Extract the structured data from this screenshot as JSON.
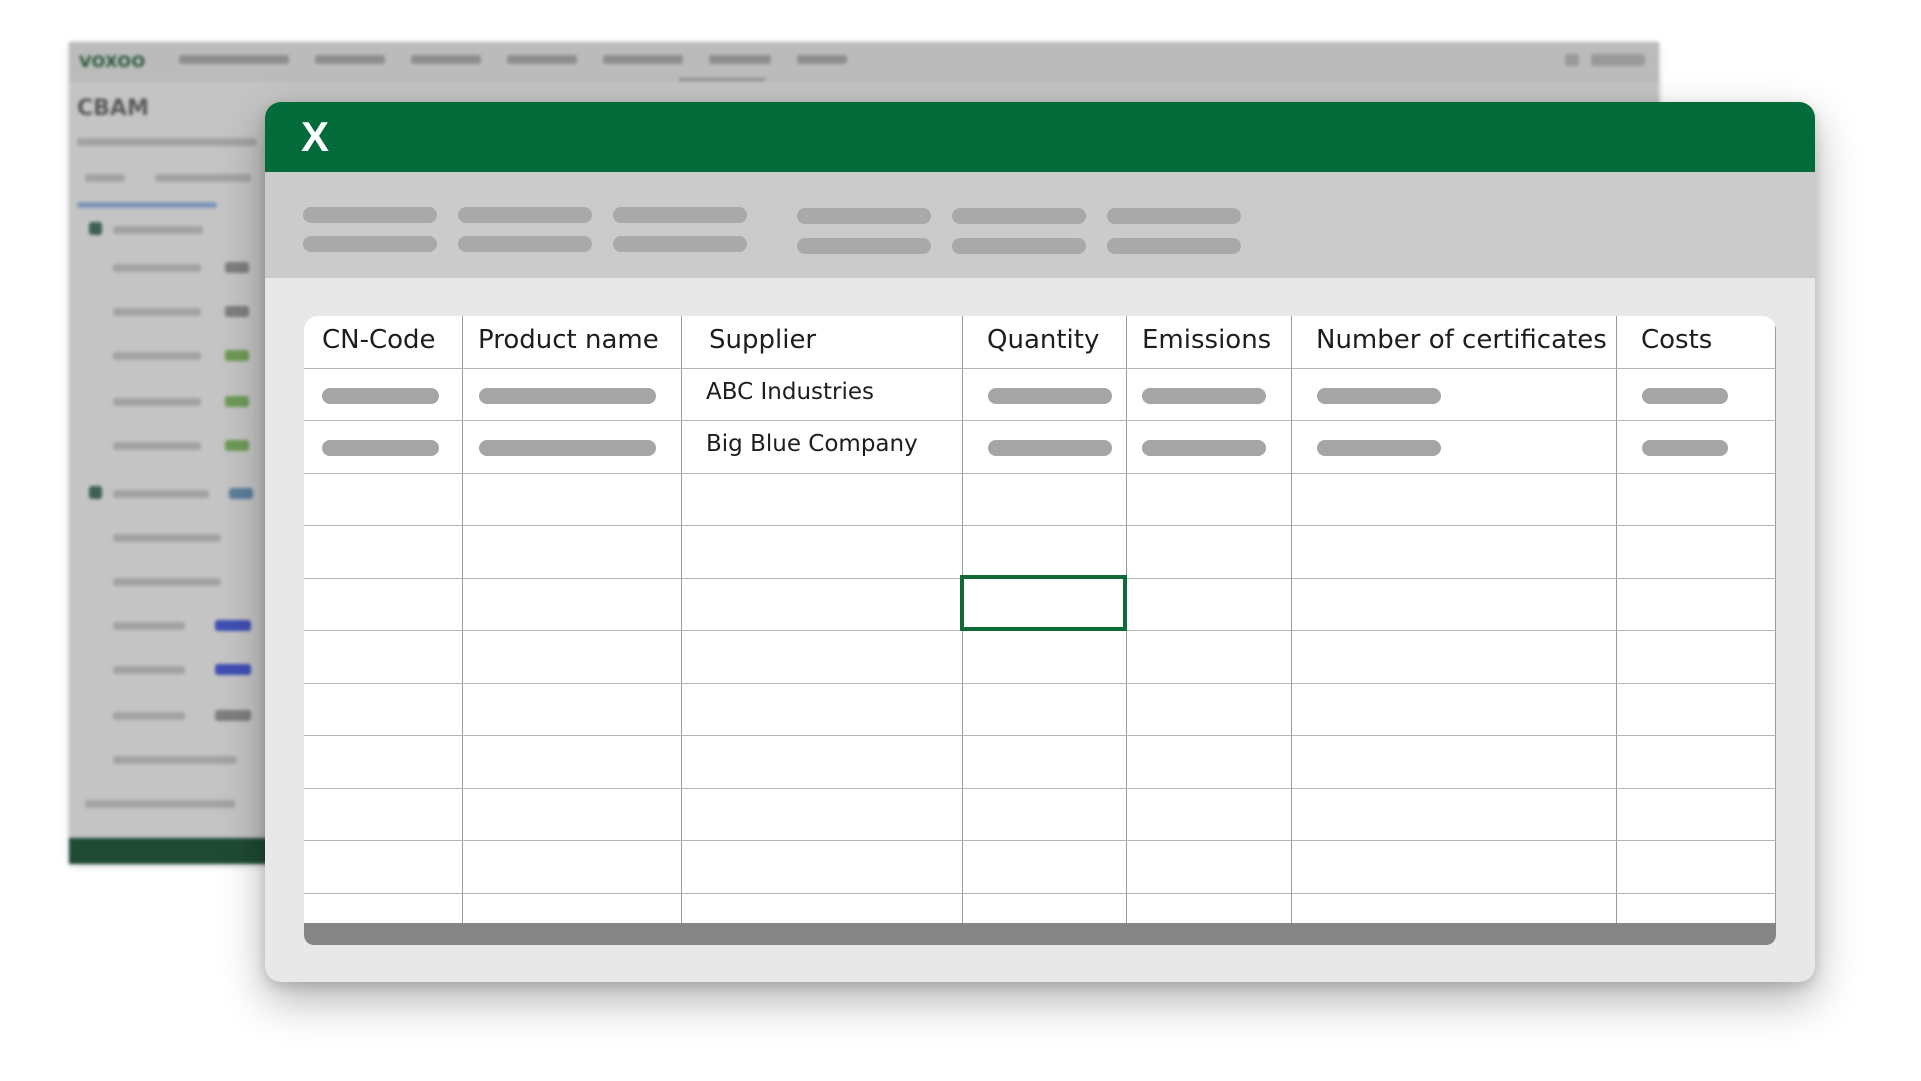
{
  "background_app": {
    "logo": "VOXOO",
    "page_title": "CBAM"
  },
  "app": {
    "logo_letter": "X",
    "accent_color": "#036b3a"
  },
  "sheet": {
    "columns": [
      "CN-Code",
      "Product name",
      "Supplier",
      "Quantity",
      "Emissions",
      "Number of certificates",
      "Costs"
    ],
    "rows": [
      {
        "supplier": "ABC Industries"
      },
      {
        "supplier": "Big Blue Company"
      }
    ],
    "selected_column": "Quantity"
  }
}
